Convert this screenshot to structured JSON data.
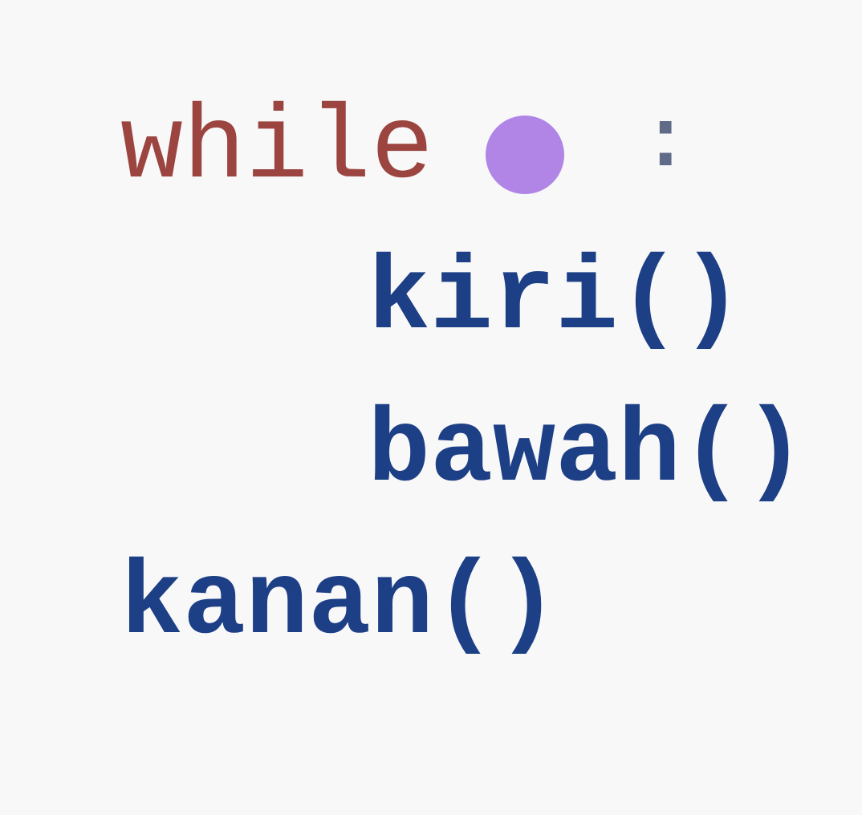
{
  "code": {
    "line1": {
      "keyword": "while",
      "placeholder": {
        "color": "#b085e6",
        "shape": "circle"
      },
      "colon": ":"
    },
    "line2": {
      "text": "kiri()"
    },
    "line3": {
      "text": "bawah()"
    },
    "line4": {
      "text": "kanan()"
    }
  },
  "colors": {
    "background": "#f8f8f8",
    "keyword": "#9b4440",
    "function": "#1d3f86",
    "colon": "#5f6b87",
    "placeholder": "#b085e6"
  }
}
